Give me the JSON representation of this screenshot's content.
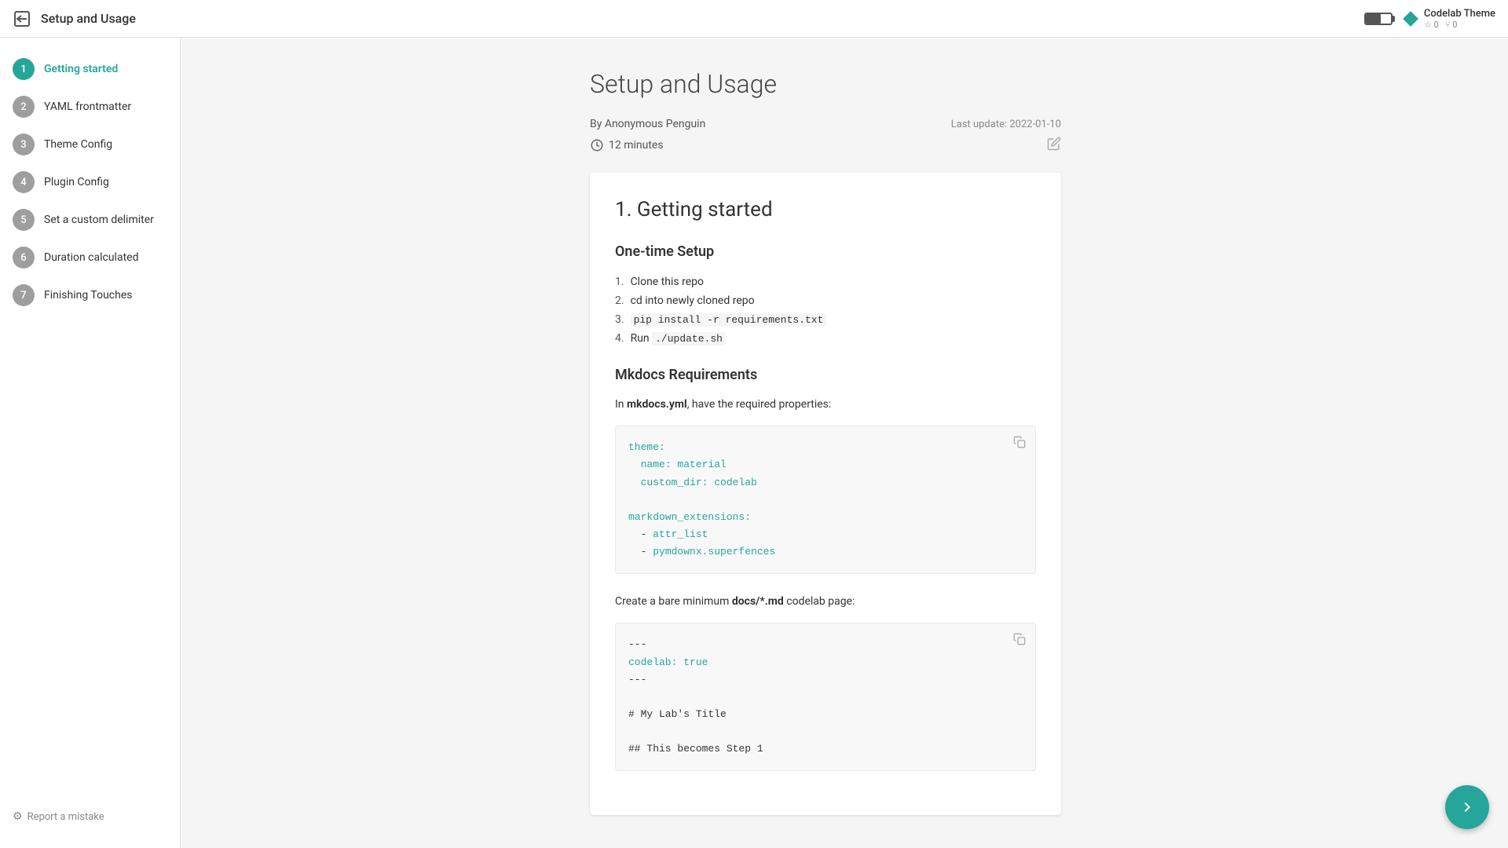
{
  "header": {
    "back_label": "←",
    "title": "Setup and Usage",
    "battery_pct": 60,
    "theme": {
      "name": "Codelab Theme",
      "stars": "☆ 0",
      "forks": "⑂ 0"
    }
  },
  "sidebar": {
    "steps": [
      {
        "num": "1",
        "label": "Getting started",
        "active": true
      },
      {
        "num": "2",
        "label": "YAML frontmatter",
        "active": false
      },
      {
        "num": "3",
        "label": "Theme Config",
        "active": false
      },
      {
        "num": "4",
        "label": "Plugin Config",
        "active": false
      },
      {
        "num": "5",
        "label": "Set a custom delimiter",
        "active": false
      },
      {
        "num": "6",
        "label": "Duration calculated",
        "active": false
      },
      {
        "num": "7",
        "label": "Finishing Touches",
        "active": false
      }
    ],
    "footer": {
      "report_mistake": "Report a mistake"
    }
  },
  "main": {
    "page_title": "Setup and Usage",
    "author": "By Anonymous Penguin",
    "last_update": "Last update: 2022-01-10",
    "duration": "12 minutes",
    "section": {
      "title": "1. Getting started",
      "one_time_setup": {
        "heading": "One-time Setup",
        "steps": [
          {
            "num": "1.",
            "text": "Clone this repo"
          },
          {
            "num": "2.",
            "text": "cd into newly cloned repo"
          },
          {
            "num": "3.",
            "text": "pip install -r requirements.txt",
            "code": "pip install -r requirements.txt"
          },
          {
            "num": "4.",
            "text": "Run ./update.sh",
            "code": "./update.sh"
          }
        ]
      },
      "mkdocs": {
        "heading": "Mkdocs Requirements",
        "intro": "In mkdocs.yml, have the required properties:",
        "code1": {
          "lines": [
            {
              "type": "key",
              "text": "theme:"
            },
            {
              "type": "indent-key",
              "text": "  name: material"
            },
            {
              "type": "indent-key",
              "text": "  custom_dir: codelab"
            },
            {
              "type": "empty",
              "text": ""
            },
            {
              "type": "key",
              "text": "markdown_extensions:"
            },
            {
              "type": "indent-key",
              "text": "  - attr_list"
            },
            {
              "type": "indent-key",
              "text": "  - pymdownx.superfences"
            }
          ]
        },
        "bare_minimum": "Create a bare minimum docs/*.md codelab page:",
        "code2": {
          "lines": [
            {
              "type": "normal",
              "text": "---"
            },
            {
              "type": "key",
              "text": "codelab: true"
            },
            {
              "type": "normal",
              "text": "---"
            },
            {
              "type": "empty",
              "text": ""
            },
            {
              "type": "normal",
              "text": "# My Lab's Title"
            },
            {
              "type": "empty",
              "text": ""
            },
            {
              "type": "normal",
              "text": "## This becomes Step 1"
            }
          ]
        }
      }
    }
  },
  "next_button": {
    "label": "→"
  }
}
